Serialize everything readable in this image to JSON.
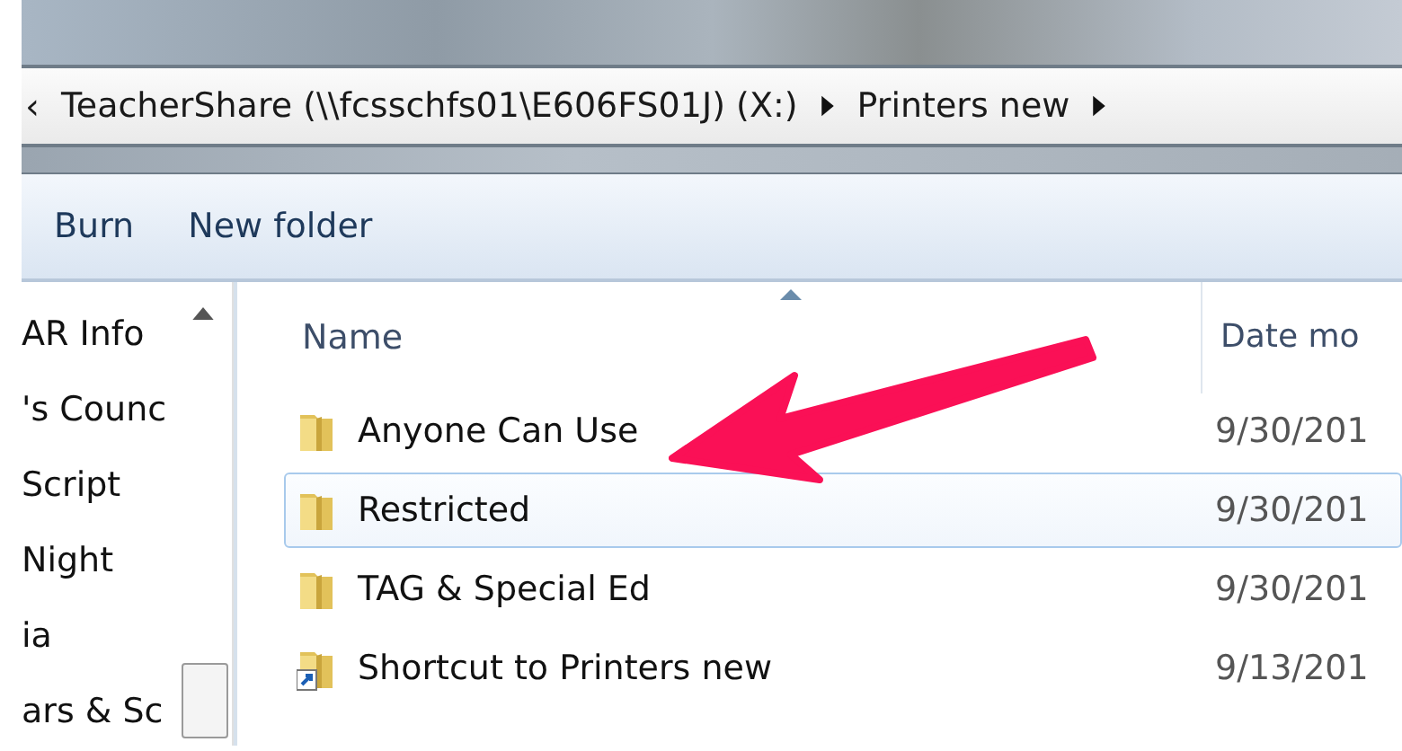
{
  "address_bar": {
    "overflow": "‹",
    "crumbs": [
      "TeacherShare (\\\\fcsschfs01\\E606FS01J) (X:)",
      "Printers new"
    ]
  },
  "toolbar": {
    "buttons": [
      "Burn",
      "New folder"
    ]
  },
  "sidebar": {
    "items": [
      "AR Info",
      "'s Counc",
      "Script",
      "Night",
      "ia",
      "ars & Sc"
    ]
  },
  "file_list": {
    "columns": [
      "Name",
      "Date mo"
    ],
    "rows": [
      {
        "kind": "folder",
        "name": "Anyone Can Use",
        "date": "9/30/201",
        "selected": false
      },
      {
        "kind": "folder",
        "name": "Restricted",
        "date": "9/30/201",
        "selected": true
      },
      {
        "kind": "folder",
        "name": "TAG & Special Ed",
        "date": "9/30/201",
        "selected": false
      },
      {
        "kind": "shortcut",
        "name": "Shortcut to Printers new",
        "date": "9/13/201",
        "selected": false
      }
    ]
  }
}
